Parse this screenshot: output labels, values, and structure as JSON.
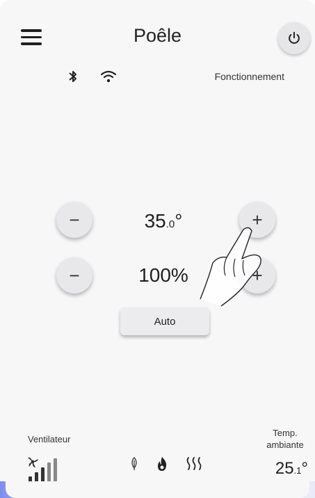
{
  "header": {
    "title": "Poêle",
    "status": "Fonctionnement"
  },
  "controls": {
    "setpoint": {
      "main": "35",
      "decimal": ".0",
      "unit": "°",
      "minus": "−",
      "plus": "+"
    },
    "power": {
      "main": "100%",
      "minus": "−",
      "plus": "+"
    },
    "mode_button": "Auto"
  },
  "footer": {
    "fan_label": "Ventilateur",
    "ambient_label_line1": "Temp.",
    "ambient_label_line2": "ambiante",
    "ambient": {
      "main": "25",
      "decimal": ".1",
      "unit": "°"
    },
    "icons": [
      "fan-level-icon",
      "leaf-icon",
      "flame-icon",
      "heat-waves-icon"
    ]
  },
  "colors": {
    "background": "#f7f7f8",
    "button": "#e8e8ea",
    "accent": "#7d8cf0"
  }
}
